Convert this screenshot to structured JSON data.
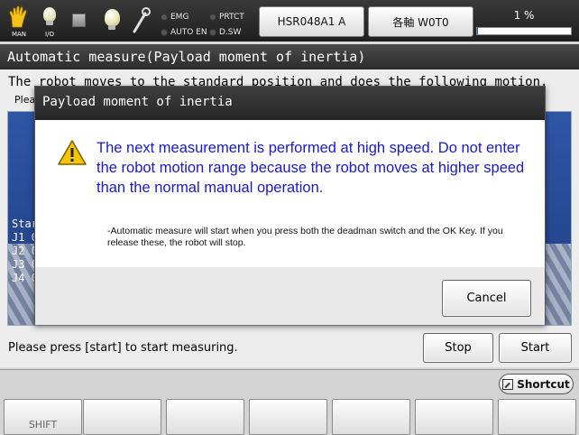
{
  "topbar": {
    "man_label": "MAN",
    "io_label": "I/O",
    "leds_left": [
      "EMG",
      "AUTO EN"
    ],
    "leds_right": [
      "PRTCT",
      "D.SW"
    ],
    "robot_button": "HSR048A1 A",
    "axis_button": "各軸  W0T0",
    "speed_text": "1 %",
    "speed_percent": 1
  },
  "panel": {
    "title": "Automatic measure(Payload moment of inertia)",
    "description": "The robot moves to the standard position and does the following motion.",
    "sub_text": "Plea",
    "view_lines": [
      "Star",
      "J1  0",
      "J2  0",
      "J3  0",
      "J4  0"
    ],
    "status_message": "Please press [start] to start measuring.",
    "stop_label": "Stop",
    "start_label": "Start"
  },
  "dialog": {
    "title": "Payload moment of inertia",
    "warning_text": "The next measurement is performed at high speed. Do not enter the robot motion range because the robot moves at higher speed than the normal manual operation.",
    "note_text": "-Automatic measure will start when you press both the deadman switch and the OK Key. If you release these, the robot will stop.",
    "cancel_label": "Cancel"
  },
  "bottombar": {
    "shortcut_label": "Shortcut",
    "function_keys": [
      "SHIFT",
      "",
      "",
      "",
      "",
      "",
      "",
      ""
    ]
  },
  "colors": {
    "warning_text": "#1a1ac8",
    "view_background": "#2e56a6",
    "title_bar": "#2c2c2c"
  }
}
